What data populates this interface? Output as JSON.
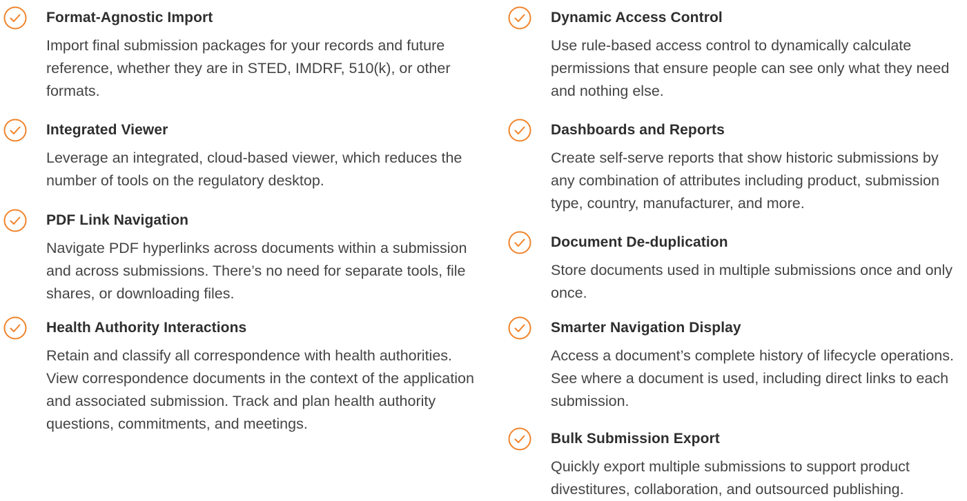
{
  "accent_color": "#f0842c",
  "left_column": [
    {
      "title": "Format-Agnostic Import",
      "description": "Import final submission packages for your records and future reference, whether they are in STED, IMDRF, 510(k), or other formats."
    },
    {
      "title": "Integrated Viewer",
      "description": "Leverage an integrated, cloud-based viewer, which reduces the number of tools on the regulatory desktop."
    },
    {
      "title": "PDF Link Navigation",
      "description": "Navigate PDF hyperlinks across documents within a submission and across submissions. There’s no need for separate tools, file shares, or downloading files."
    },
    {
      "title": "Health Authority Interactions",
      "description": "Retain and classify all correspondence with health authorities. View correspondence documents in the context of the application and associated submission. Track and plan health authority questions, commitments, and meetings."
    }
  ],
  "right_column": [
    {
      "title": "Dynamic Access Control",
      "description": "Use rule-based access control to dynamically calculate permissions that ensure people can see only what they need and nothing else."
    },
    {
      "title": "Dashboards and Reports",
      "description": "Create self-serve reports that show historic submissions by any combination of attributes including product, submission type, country, manufacturer, and more."
    },
    {
      "title": "Document De-duplication",
      "description": "Store documents used in multiple submissions once and only once."
    },
    {
      "title": "Smarter Navigation Display",
      "description": "Access a document’s complete history of lifecycle operations. See where a document is used, including direct links to each submission."
    },
    {
      "title": "Bulk Submission Export",
      "description": "Quickly export multiple submissions to support product divestitures, collaboration, and outsourced publishing."
    }
  ]
}
